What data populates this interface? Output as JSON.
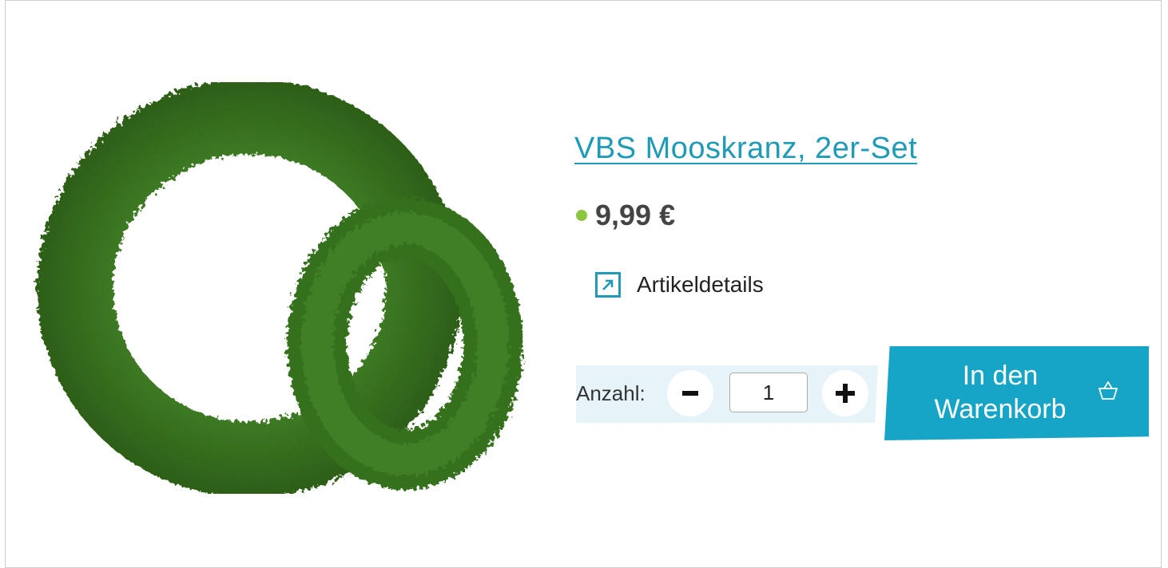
{
  "product": {
    "title": "VBS Mooskranz, 2er-Set",
    "image_alt": "VBS Mooskranz, 2er-Set",
    "price": "9,99 €",
    "availability_color": "#8cc63f"
  },
  "details_link": {
    "label": "Artikeldetails",
    "icon": "external-arrow-icon"
  },
  "quantity": {
    "label": "Anzahl:",
    "value": "1",
    "decrease_icon": "minus-icon",
    "increase_icon": "plus-icon"
  },
  "cart": {
    "label": "In den Warenkorb",
    "icon": "basket-icon"
  },
  "colors": {
    "accent": "#16a5c6",
    "title": "#1f9bb7",
    "panel": "#e6f4f9",
    "moss": "#3f7d24"
  }
}
